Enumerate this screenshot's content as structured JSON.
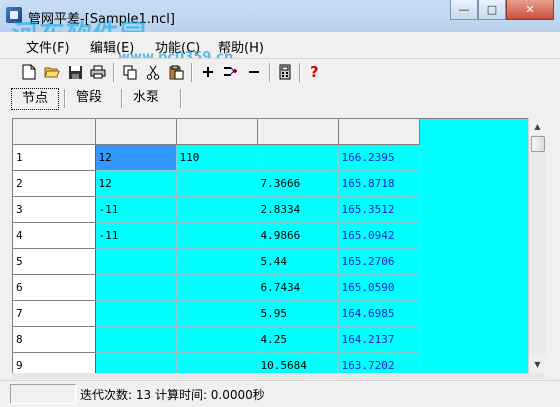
{
  "window": {
    "title": "管网平差-[Sample1.ncl]",
    "watermark_logo": "河东软件园",
    "watermark_url": "www.pc0359.cn",
    "buttons": {
      "minimize": "—",
      "maximize": "□",
      "close": "✕"
    }
  },
  "menu": {
    "items": [
      "文件(F)",
      "编辑(E)",
      "功能(C)",
      "帮助(H)"
    ]
  },
  "toolbar": {
    "icons": [
      "new-file-icon",
      "open-folder-icon",
      "save-icon",
      "print-icon",
      "copy-icon",
      "cut-icon",
      "paste-icon",
      "add-icon",
      "insert-icon",
      "remove-icon",
      "calculator-icon",
      "help-icon"
    ]
  },
  "tabs": [
    "节点",
    "管段",
    "水泵"
  ],
  "grid": {
    "headers": [
      "",
      "",
      "",
      "",
      ""
    ],
    "rows": [
      {
        "id": "1",
        "c1": "12",
        "c2": "110",
        "c3": "",
        "c4": "166.2395"
      },
      {
        "id": "2",
        "c1": "12",
        "c2": "",
        "c3": "7.3666",
        "c4": "165.8718"
      },
      {
        "id": "3",
        "c1": "-11",
        "c2": "",
        "c3": "2.8334",
        "c4": "165.3512"
      },
      {
        "id": "4",
        "c1": "-11",
        "c2": "",
        "c3": "4.9866",
        "c4": "165.0942"
      },
      {
        "id": "5",
        "c1": "",
        "c2": "",
        "c3": "5.44",
        "c4": "165.2706"
      },
      {
        "id": "6",
        "c1": "",
        "c2": "",
        "c3": "6.7434",
        "c4": "165.0590"
      },
      {
        "id": "7",
        "c1": "",
        "c2": "",
        "c3": "5.95",
        "c4": "164.6985"
      },
      {
        "id": "8",
        "c1": "",
        "c2": "",
        "c3": "4.25",
        "c4": "164.2137"
      },
      {
        "id": "9",
        "c1": "",
        "c2": "",
        "c3": "10.5684",
        "c4": "163.7202"
      }
    ]
  },
  "status": {
    "text": "迭代次数: 13 计算时间: 0.0000秒"
  },
  "colors": {
    "grid_bg": "#00ffff",
    "selected_cell": "#3399ff",
    "value_text": "#2020d0"
  }
}
